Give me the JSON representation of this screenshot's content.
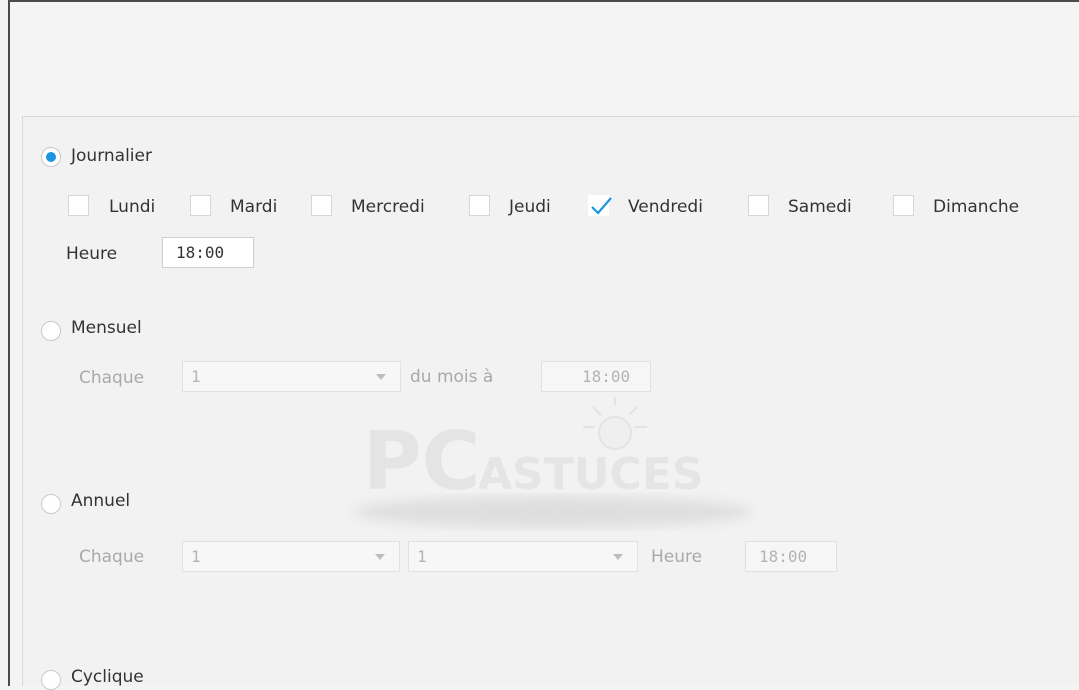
{
  "schedule": {
    "daily": {
      "label": "Journalier",
      "selected": true,
      "days": [
        {
          "label": "Lundi",
          "checked": false
        },
        {
          "label": "Mardi",
          "checked": false
        },
        {
          "label": "Mercredi",
          "checked": false
        },
        {
          "label": "Jeudi",
          "checked": false
        },
        {
          "label": "Vendredi",
          "checked": true
        },
        {
          "label": "Samedi",
          "checked": false
        },
        {
          "label": "Dimanche",
          "checked": false
        }
      ],
      "time_label": "Heure",
      "time_value": "18:00"
    },
    "monthly": {
      "label": "Mensuel",
      "selected": false,
      "every_label": "Chaque",
      "day_value": "1",
      "of_month_label": "du mois à",
      "time_value": "18:00"
    },
    "yearly": {
      "label": "Annuel",
      "selected": false,
      "every_label": "Chaque",
      "day_value": "1",
      "month_value": "1",
      "time_label": "Heure",
      "time_value": "18:00"
    },
    "cyclic": {
      "label": "Cyclique",
      "selected": false
    }
  },
  "watermark": {
    "brand": "PCASTUCES"
  },
  "colors": {
    "accent": "#1a95e0",
    "frame": "#4a4a4a"
  }
}
